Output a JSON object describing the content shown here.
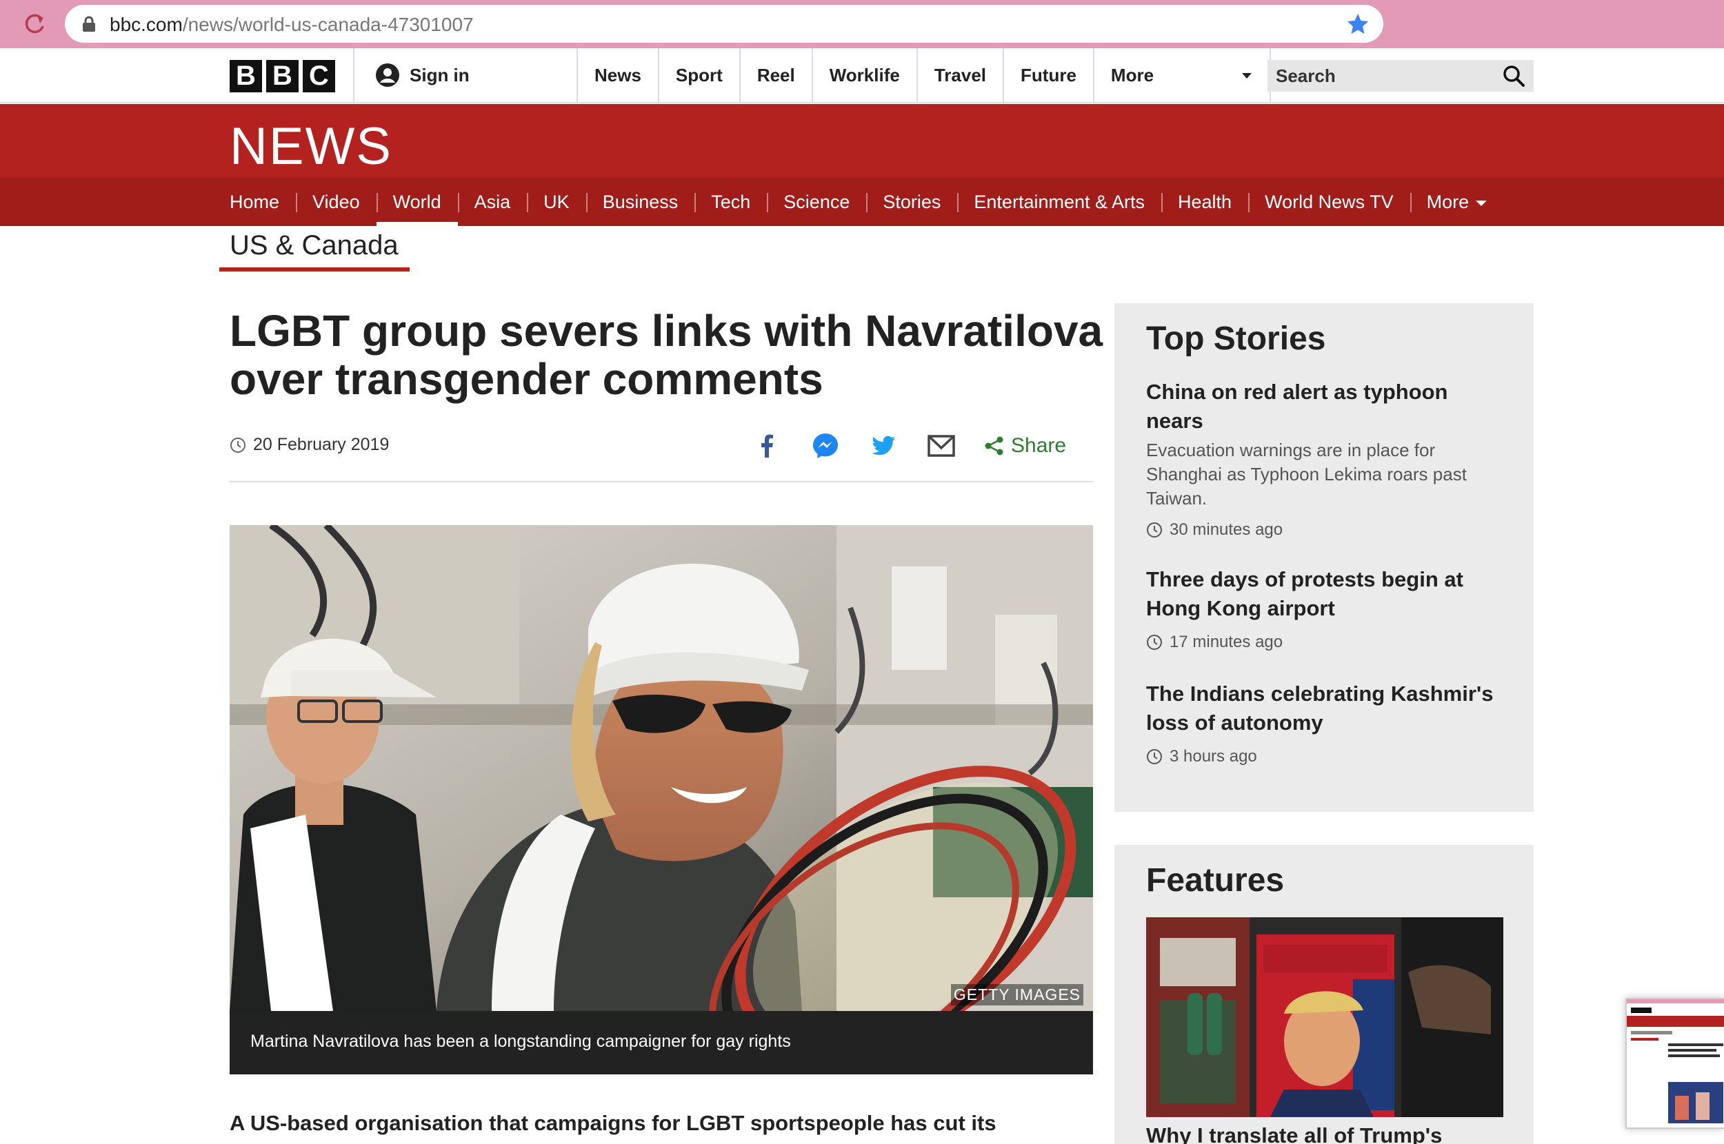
{
  "browser": {
    "url_host": "bbc.com",
    "url_path": "/news/world-us-canada-47301007"
  },
  "masthead": {
    "logo_letters": [
      "B",
      "B",
      "C"
    ],
    "signin_label": "Sign in",
    "nav": [
      "News",
      "Sport",
      "Reel",
      "Worklife",
      "Travel",
      "Future"
    ],
    "more_label": "More",
    "search_placeholder": "Search"
  },
  "banner": {
    "title": "NEWS",
    "nav": [
      "Home",
      "Video",
      "World",
      "Asia",
      "UK",
      "Business",
      "Tech",
      "Science",
      "Stories",
      "Entertainment & Arts",
      "Health",
      "World News TV",
      "More"
    ],
    "active": "World"
  },
  "section": {
    "title": "US & Canada"
  },
  "article": {
    "headline": "LGBT group severs links with Navratilova over transgender comments",
    "date": "20 February 2019",
    "share_label": "Share",
    "share_icons": [
      "facebook-icon",
      "messenger-icon",
      "twitter-icon",
      "email-icon"
    ],
    "image_credit": "GETTY IMAGES",
    "caption": "Martina Navratilova has been a longstanding campaigner for gay rights",
    "lead": "A US-based organisation that campaigns for LGBT sportspeople has cut its"
  },
  "top_stories": {
    "title": "Top Stories",
    "items": [
      {
        "title": "China on red alert as typhoon nears",
        "summary": "Evacuation warnings are in place for Shanghai as Typhoon Lekima roars past Taiwan.",
        "time": "30 minutes ago"
      },
      {
        "title": "Three days of protests begin at Hong Kong airport",
        "summary": "",
        "time": "17 minutes ago"
      },
      {
        "title": "The Indians celebrating Kashmir's loss of autonomy",
        "summary": "",
        "time": "3 hours ago"
      }
    ]
  },
  "features": {
    "title": "Features",
    "first_headline": "Why I translate all of Trump's"
  },
  "colors": {
    "bbc_red": "#b3221f",
    "bbc_red_dark": "#a11d1a",
    "chrome_pink": "#e39ab6",
    "share_green": "#2e7c2e"
  }
}
